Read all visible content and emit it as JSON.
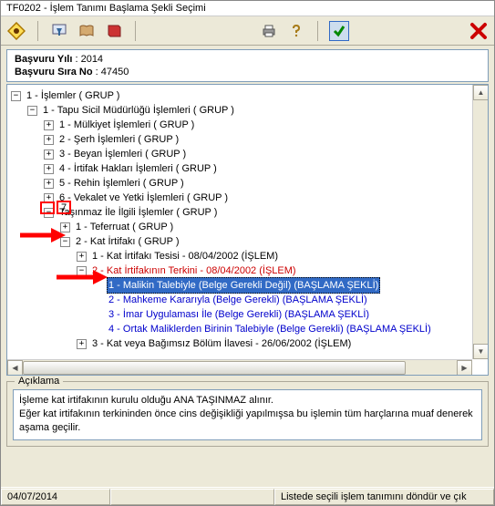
{
  "window": {
    "title": "TF0202 -  İşlem Tanımı Başlama Şekli Seçimi"
  },
  "info": {
    "year_label": "Başvuru Yılı",
    "year_value": "2014",
    "seq_label": "Başvuru Sıra No",
    "seq_value": "47450"
  },
  "tree": [
    {
      "indent": 0,
      "exp": "-",
      "text": "1 - İşlemler ( GRUP )",
      "cls": ""
    },
    {
      "indent": 1,
      "exp": "-",
      "text": "1 - Tapu Sicil Müdürlüğü İşlemleri ( GRUP )",
      "cls": ""
    },
    {
      "indent": 2,
      "exp": "+",
      "text": "1 - Mülkiyet İşlemleri ( GRUP )",
      "cls": ""
    },
    {
      "indent": 2,
      "exp": "+",
      "text": "2 - Şerh İşlemleri ( GRUP )",
      "cls": ""
    },
    {
      "indent": 2,
      "exp": "+",
      "text": "3 - Beyan İşlemleri ( GRUP )",
      "cls": ""
    },
    {
      "indent": 2,
      "exp": "+",
      "text": "4 - İrtifak Hakları İşlemleri ( GRUP )",
      "cls": ""
    },
    {
      "indent": 2,
      "exp": "+",
      "text": "5 - Rehin İşlemleri ( GRUP )",
      "cls": ""
    },
    {
      "indent": 2,
      "exp": "+",
      "text": "6 - Vekalet ve Yetki İşlemleri ( GRUP )",
      "cls": ""
    },
    {
      "indent": 2,
      "exp": "-",
      "text": "   Taşınmaz İle İlgili İşlemler ( GRUP )",
      "cls": "",
      "box7": true
    },
    {
      "indent": 3,
      "exp": "+",
      "text": "1 - Teferruat ( GRUP )",
      "cls": ""
    },
    {
      "indent": 3,
      "exp": "-",
      "text": "2 - Kat İrtifakı ( GRUP )",
      "cls": "",
      "arrow1": true
    },
    {
      "indent": 4,
      "exp": "+",
      "text": "1 - Kat İrtifakı Tesisi - 08/04/2002 (İŞLEM)",
      "cls": ""
    },
    {
      "indent": 4,
      "exp": "-",
      "text": "2 - Kat İrtifakının Terkini - 08/04/2002 (İŞLEM)",
      "cls": "red"
    },
    {
      "indent": 5,
      "exp": "",
      "text": "1 - Malikin Talebiyle (Belge Gerekli Değil) (BAŞLAMA ŞEKLİ)",
      "cls": "sel",
      "arrow2": true
    },
    {
      "indent": 5,
      "exp": "",
      "text": "2 - Mahkeme Kararıyla (Belge Gerekli) (BAŞLAMA ŞEKLİ)",
      "cls": "blue"
    },
    {
      "indent": 5,
      "exp": "",
      "text": "3 - İmar Uygulaması İle (Belge Gerekli) (BAŞLAMA ŞEKLİ)",
      "cls": "blue"
    },
    {
      "indent": 5,
      "exp": "",
      "text": "4 - Ortak Maliklerden Birinin Talebiyle (Belge Gerekli) (BAŞLAMA ŞEKLİ)",
      "cls": "blue"
    },
    {
      "indent": 4,
      "exp": "+",
      "text": "3 - Kat veya Bağımsız Bölüm İlavesi - 26/06/2002 (İŞLEM)",
      "cls": ""
    }
  ],
  "box7_text": "7",
  "desc": {
    "legend": "Açıklama",
    "line1": "İşleme kat irtifakının kurulu olduğu ANA TAŞINMAZ alınır.",
    "line2": "Eğer kat irtifakının terkininden önce cins değişikliği yapılmışsa bu işlemin tüm harçlarına muaf denerek aşama geçilir."
  },
  "status": {
    "date": "04/07/2014",
    "hint": "Listede seçili işlem tanımını döndür ve çık"
  },
  "colors": {
    "selection": "#316ac5",
    "red": "#cc0000",
    "blue": "#0000cc"
  }
}
